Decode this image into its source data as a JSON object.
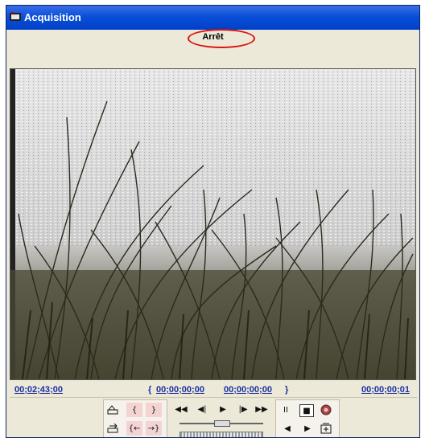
{
  "window": {
    "title": "Acquisition"
  },
  "status": {
    "text": "Arrêt",
    "highlight_color": "#e01010"
  },
  "timecodes": {
    "current": "00;02;43;00",
    "in_open": "{",
    "in_point": "00;00;00;00",
    "out_point": "00;00;00;00",
    "out_close": "}",
    "duration": "00;00;00;01"
  },
  "controls": {
    "set_in_icon": "set-in-icon",
    "set_out_icon": "set-out-icon",
    "brace_left": "{",
    "brace_right": "}",
    "goto_in": "{←",
    "goto_out": "→}",
    "rewind": "◀◀",
    "step_back": "◀|",
    "play": "▶",
    "step_forward": "|▶",
    "fast_forward": "▶▶",
    "pause": "II",
    "stop": "■",
    "record": "●",
    "prev_scene": "◀",
    "next_scene": "▶"
  },
  "shuttle": {
    "position": 0.5
  }
}
